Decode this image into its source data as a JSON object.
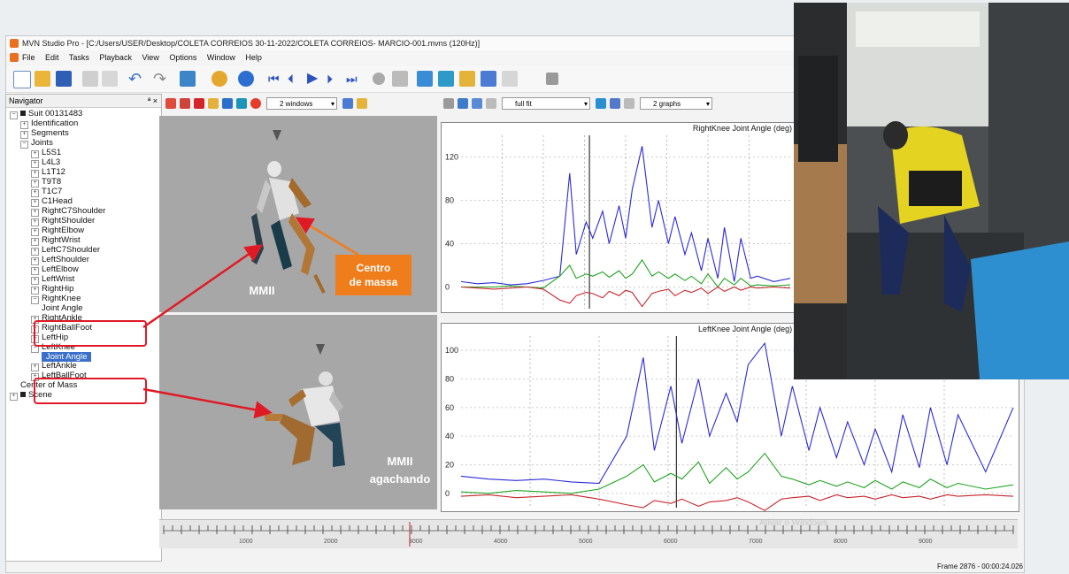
{
  "window": {
    "title": "MVN Studio Pro - [C:/Users/USER/Desktop/COLETA CORREIOS 30-11-2022/COLETA CORREIOS- MARCIO-001.mvns (120Hz)]"
  },
  "menu": [
    "File",
    "Edit",
    "Tasks",
    "Playback",
    "View",
    "Options",
    "Window",
    "Help"
  ],
  "navigator": {
    "title": "Navigator",
    "pin": "ª ×",
    "items": [
      {
        "label": "Suit 00131483",
        "level": 0,
        "exp": "−",
        "icon": "suit-icon"
      },
      {
        "label": "Identification",
        "level": 1,
        "exp": "+"
      },
      {
        "label": "Segments",
        "level": 1,
        "exp": "+"
      },
      {
        "label": "Joints",
        "level": 1,
        "exp": "−"
      },
      {
        "label": "L5S1",
        "level": 2,
        "exp": "+"
      },
      {
        "label": "L4L3",
        "level": 2,
        "exp": "+"
      },
      {
        "label": "L1T12",
        "level": 2,
        "exp": "+"
      },
      {
        "label": "T9T8",
        "level": 2,
        "exp": "+"
      },
      {
        "label": "T1C7",
        "level": 2,
        "exp": "+"
      },
      {
        "label": "C1Head",
        "level": 2,
        "exp": "+"
      },
      {
        "label": "RightC7Shoulder",
        "level": 2,
        "exp": "+"
      },
      {
        "label": "RightShoulder",
        "level": 2,
        "exp": "+"
      },
      {
        "label": "RightElbow",
        "level": 2,
        "exp": "+"
      },
      {
        "label": "RightWrist",
        "level": 2,
        "exp": "+"
      },
      {
        "label": "LeftC7Shoulder",
        "level": 2,
        "exp": "+"
      },
      {
        "label": "LeftShoulder",
        "level": 2,
        "exp": "+"
      },
      {
        "label": "LeftElbow",
        "level": 2,
        "exp": "+"
      },
      {
        "label": "LeftWrist",
        "level": 2,
        "exp": "+"
      },
      {
        "label": "RightHip",
        "level": 2,
        "exp": "+"
      },
      {
        "label": "RightKnee",
        "level": 2,
        "exp": "−"
      },
      {
        "label": "Joint Angle",
        "level": 3,
        "exp": ""
      },
      {
        "label": "RightAnkle",
        "level": 2,
        "exp": "+"
      },
      {
        "label": "RightBallFoot",
        "level": 2,
        "exp": "+"
      },
      {
        "label": "LeftHip",
        "level": 2,
        "exp": "+"
      },
      {
        "label": "LeftKnee",
        "level": 2,
        "exp": "−"
      },
      {
        "label": "Joint Angle",
        "level": 3,
        "exp": "",
        "selected": true
      },
      {
        "label": "LeftAnkle",
        "level": 2,
        "exp": "+"
      },
      {
        "label": "LeftBallFoot",
        "level": 2,
        "exp": "+"
      },
      {
        "label": "Center of Mass",
        "level": 1,
        "exp": ""
      },
      {
        "label": "Scene",
        "level": 0,
        "exp": "+",
        "icon": "scene-icon"
      }
    ]
  },
  "viewer_toolbar": {
    "windows_dropdown": "2 windows"
  },
  "graph_toolbar": {
    "fit_dropdown": "full fit",
    "graphs_dropdown": "2 graphs"
  },
  "viewer": {
    "top_label": "MMII",
    "callout": "Centro\nde massa",
    "bottom_label": "MMII\nagachando"
  },
  "graphs": [
    {
      "title": "RightKnee Joint Angle (deg)",
      "yticks": [
        "120",
        "80",
        "40",
        "0"
      ]
    },
    {
      "title": "LeftKnee Joint Angle (deg)",
      "yticks": [
        "100",
        "80",
        "60",
        "40",
        "20",
        "0"
      ]
    }
  ],
  "timeline": {
    "ticks": [
      "1000",
      "2000",
      "3000",
      "4000",
      "5000",
      "6000",
      "7000",
      "8000",
      "9000"
    ]
  },
  "status": {
    "frame": "Frame 2876 - 00:00:24.026"
  },
  "watermark": "Ativar o Windows",
  "colors": {
    "x_axis": "#2b2bd6",
    "y_axis": "#1fa31f",
    "z_axis": "#c8262e",
    "annotation_red": "#e01a25",
    "callout_orange": "#f07d1c",
    "selection": "#3b6fc9"
  },
  "chart_data": [
    {
      "type": "line",
      "title": "RightKnee Joint Angle (deg)",
      "ylim": [
        -20,
        140
      ],
      "x": [
        0,
        0.05,
        0.1,
        0.15,
        0.2,
        0.25,
        0.3,
        0.33,
        0.35,
        0.38,
        0.4,
        0.43,
        0.45,
        0.48,
        0.5,
        0.52,
        0.55,
        0.58,
        0.6,
        0.63,
        0.65,
        0.68,
        0.7,
        0.73,
        0.75,
        0.78,
        0.8,
        0.83,
        0.85,
        0.88,
        0.9,
        0.95,
        1.0
      ],
      "series": [
        {
          "values": [
            5,
            3,
            4,
            2,
            3,
            6,
            10,
            105,
            30,
            60,
            45,
            70,
            40,
            75,
            45,
            90,
            130,
            55,
            80,
            40,
            65,
            30,
            50,
            15,
            45,
            8,
            55,
            5,
            45,
            8,
            10,
            5,
            8
          ]
        },
        {
          "values": [
            0,
            0,
            0,
            1,
            0,
            -1,
            10,
            20,
            8,
            12,
            10,
            14,
            9,
            15,
            8,
            12,
            25,
            10,
            14,
            8,
            12,
            6,
            10,
            3,
            12,
            0,
            8,
            2,
            8,
            1,
            2,
            1,
            2
          ]
        },
        {
          "values": [
            0,
            -1,
            -2,
            -1,
            0,
            -2,
            -12,
            -15,
            -8,
            -5,
            -6,
            -10,
            -4,
            -8,
            -3,
            -5,
            -18,
            -6,
            -4,
            -2,
            -8,
            -3,
            -5,
            -1,
            -6,
            0,
            -4,
            0,
            -3,
            0,
            -1,
            0,
            -1
          ]
        }
      ]
    },
    {
      "type": "line",
      "title": "LeftKnee Joint Angle (deg)",
      "ylim": [
        -10,
        110
      ],
      "x": [
        0,
        0.05,
        0.1,
        0.15,
        0.2,
        0.25,
        0.3,
        0.33,
        0.35,
        0.38,
        0.4,
        0.43,
        0.45,
        0.48,
        0.5,
        0.52,
        0.55,
        0.58,
        0.6,
        0.63,
        0.65,
        0.68,
        0.7,
        0.73,
        0.75,
        0.78,
        0.8,
        0.83,
        0.85,
        0.88,
        0.9,
        0.95,
        1.0
      ],
      "series": [
        {
          "values": [
            12,
            10,
            9,
            10,
            8,
            7,
            40,
            95,
            30,
            75,
            35,
            80,
            40,
            70,
            50,
            90,
            105,
            40,
            75,
            30,
            60,
            25,
            50,
            20,
            45,
            15,
            55,
            18,
            60,
            20,
            55,
            15,
            60
          ]
        },
        {
          "values": [
            1,
            0,
            2,
            1,
            0,
            3,
            12,
            20,
            8,
            14,
            10,
            22,
            7,
            18,
            10,
            15,
            28,
            12,
            10,
            6,
            9,
            5,
            8,
            4,
            9,
            3,
            8,
            4,
            10,
            4,
            7,
            3,
            6
          ]
        },
        {
          "values": [
            -2,
            -1,
            -3,
            -2,
            -1,
            -4,
            -8,
            -10,
            -5,
            -7,
            -4,
            -9,
            -6,
            -5,
            -3,
            -6,
            -12,
            -4,
            -3,
            -2,
            -5,
            -1,
            -3,
            -2,
            -4,
            -1,
            -3,
            -2,
            -4,
            -1,
            -2,
            -1,
            -2
          ]
        }
      ]
    }
  ]
}
